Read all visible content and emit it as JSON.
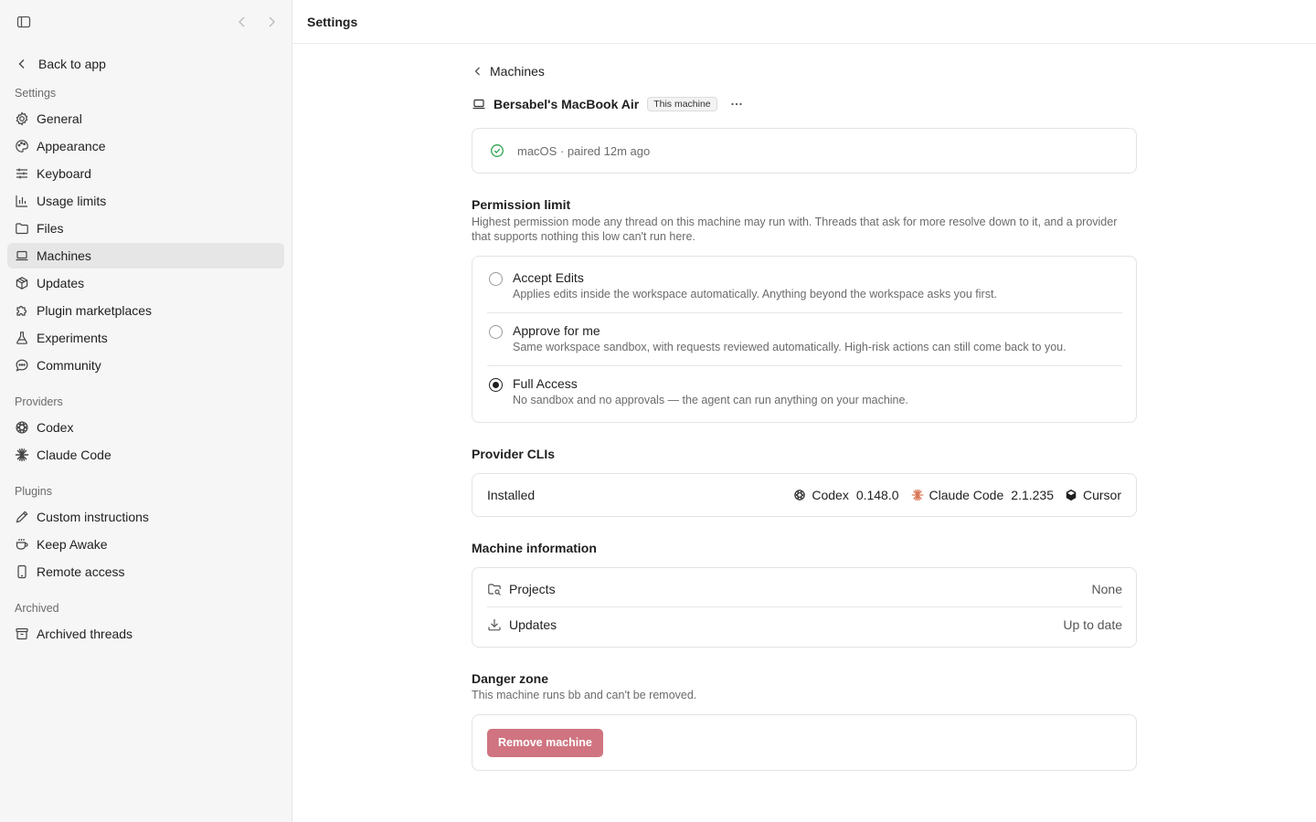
{
  "sidebar": {
    "back_label": "Back to app",
    "sections": {
      "settings": "Settings",
      "providers": "Providers",
      "plugins": "Plugins",
      "archived": "Archived"
    },
    "settings_items": [
      {
        "label": "General",
        "icon": "gear-icon"
      },
      {
        "label": "Appearance",
        "icon": "palette-icon"
      },
      {
        "label": "Keyboard",
        "icon": "sliders-icon"
      },
      {
        "label": "Usage limits",
        "icon": "bar-chart-icon"
      },
      {
        "label": "Files",
        "icon": "folder-icon"
      },
      {
        "label": "Machines",
        "icon": "laptop-icon",
        "active": true
      },
      {
        "label": "Updates",
        "icon": "package-icon"
      },
      {
        "label": "Plugin marketplaces",
        "icon": "puzzle-icon"
      },
      {
        "label": "Experiments",
        "icon": "flask-icon"
      },
      {
        "label": "Community",
        "icon": "chat-bubble-icon"
      }
    ],
    "provider_items": [
      {
        "label": "Codex",
        "icon": "openai-icon"
      },
      {
        "label": "Claude Code",
        "icon": "claude-spark-icon"
      }
    ],
    "plugin_items": [
      {
        "label": "Custom instructions",
        "icon": "pencil-icon"
      },
      {
        "label": "Keep Awake",
        "icon": "coffee-cup-icon"
      },
      {
        "label": "Remote access",
        "icon": "phone-icon"
      }
    ],
    "archived_items": [
      {
        "label": "Archived threads",
        "icon": "archive-box-icon"
      }
    ]
  },
  "header": {
    "title": "Settings"
  },
  "breadcrumb": {
    "label": "Machines"
  },
  "machine": {
    "name": "Bersabel's MacBook Air",
    "badge": "This machine",
    "status": "macOS · paired 12m ago"
  },
  "permission": {
    "title": "Permission limit",
    "description": "Highest permission mode any thread on this machine may run with. Threads that ask for more resolve down to it, and a provider that supports nothing this low can't run here.",
    "options": [
      {
        "label": "Accept Edits",
        "description": "Applies edits inside the workspace automatically. Anything beyond the workspace asks you first.",
        "selected": false
      },
      {
        "label": "Approve for me",
        "description": "Same workspace sandbox, with requests reviewed automatically. High-risk actions can still come back to you.",
        "selected": false
      },
      {
        "label": "Full Access",
        "description": "No sandbox and no approvals — the agent can run anything on your machine.",
        "selected": true
      }
    ]
  },
  "provider_clis": {
    "title": "Provider CLIs",
    "installed_label": "Installed",
    "items": [
      {
        "name": "Codex",
        "version": "0.148.0",
        "icon": "openai-icon"
      },
      {
        "name": "Claude Code",
        "version": "2.1.235",
        "icon": "claude-spark-icon",
        "color": "#d97757"
      },
      {
        "name": "Cursor",
        "version": "",
        "icon": "cursor-cube-icon"
      }
    ]
  },
  "machine_info": {
    "title": "Machine information",
    "rows": [
      {
        "label": "Projects",
        "value": "None",
        "icon": "folder-search-icon"
      },
      {
        "label": "Updates",
        "value": "Up to date",
        "icon": "download-icon"
      }
    ]
  },
  "danger": {
    "title": "Danger zone",
    "description": "This machine runs bb and can't be removed.",
    "button_label": "Remove machine",
    "button_color": "#cf7480"
  }
}
